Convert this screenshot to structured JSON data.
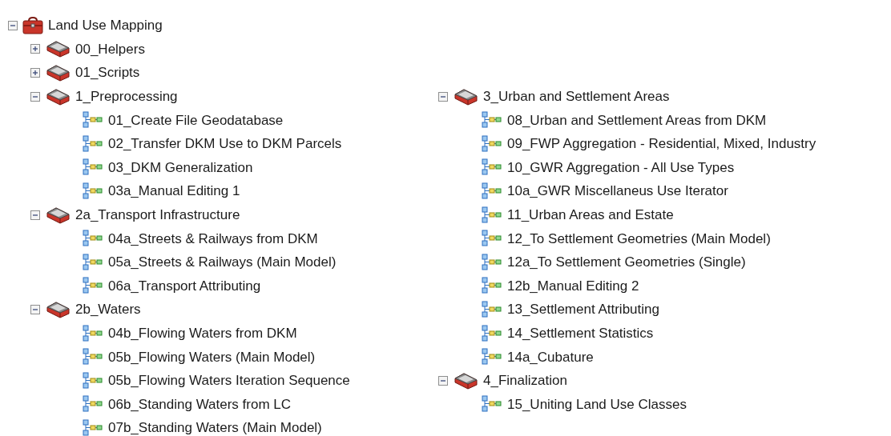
{
  "tree": {
    "label": "Land Use Mapping",
    "expanded": true,
    "children": [
      {
        "label": "00_Helpers",
        "expanded": false
      },
      {
        "label": "01_Scripts",
        "expanded": false
      },
      {
        "label": "1_Preprocessing",
        "expanded": true,
        "children": [
          {
            "label": "01_Create File Geodatabase"
          },
          {
            "label": "02_Transfer DKM Use to DKM Parcels"
          },
          {
            "label": "03_DKM Generalization"
          },
          {
            "label": "03a_Manual Editing 1"
          }
        ]
      },
      {
        "label": "2a_Transport Infrastructure",
        "expanded": true,
        "children": [
          {
            "label": "04a_Streets & Railways from DKM"
          },
          {
            "label": "05a_Streets & Railways (Main Model)"
          },
          {
            "label": "06a_Transport Attributing"
          }
        ]
      },
      {
        "label": "2b_Waters",
        "expanded": true,
        "children": [
          {
            "label": "04b_Flowing Waters from DKM"
          },
          {
            "label": "05b_Flowing Waters (Main Model)"
          },
          {
            "label": "05b_Flowing Waters Iteration Sequence"
          },
          {
            "label": "06b_Standing Waters from LC"
          },
          {
            "label": "07b_Standing Waters (Main Model)"
          }
        ]
      },
      {
        "label": "3_Urban and Settlement Areas",
        "expanded": true,
        "children": [
          {
            "label": "08_Urban and Settlement Areas from DKM"
          },
          {
            "label": "09_FWP Aggregation - Residential, Mixed, Industry"
          },
          {
            "label": "10_GWR Aggregation - All Use Types"
          },
          {
            "label": "10a_GWR Miscellaneus Use Iterator"
          },
          {
            "label": "11_Urban Areas and Estate"
          },
          {
            "label": "12_To Settlement Geometries (Main Model)"
          },
          {
            "label": "12a_To Settlement Geometries (Single)"
          },
          {
            "label": "12b_Manual Editing 2"
          },
          {
            "label": "13_Settlement Attributing"
          },
          {
            "label": "14_Settlement Statistics"
          },
          {
            "label": "14a_Cubature"
          }
        ]
      },
      {
        "label": "4_Finalization",
        "expanded": true,
        "children": [
          {
            "label": "15_Uniting Land Use Classes"
          }
        ]
      }
    ]
  }
}
